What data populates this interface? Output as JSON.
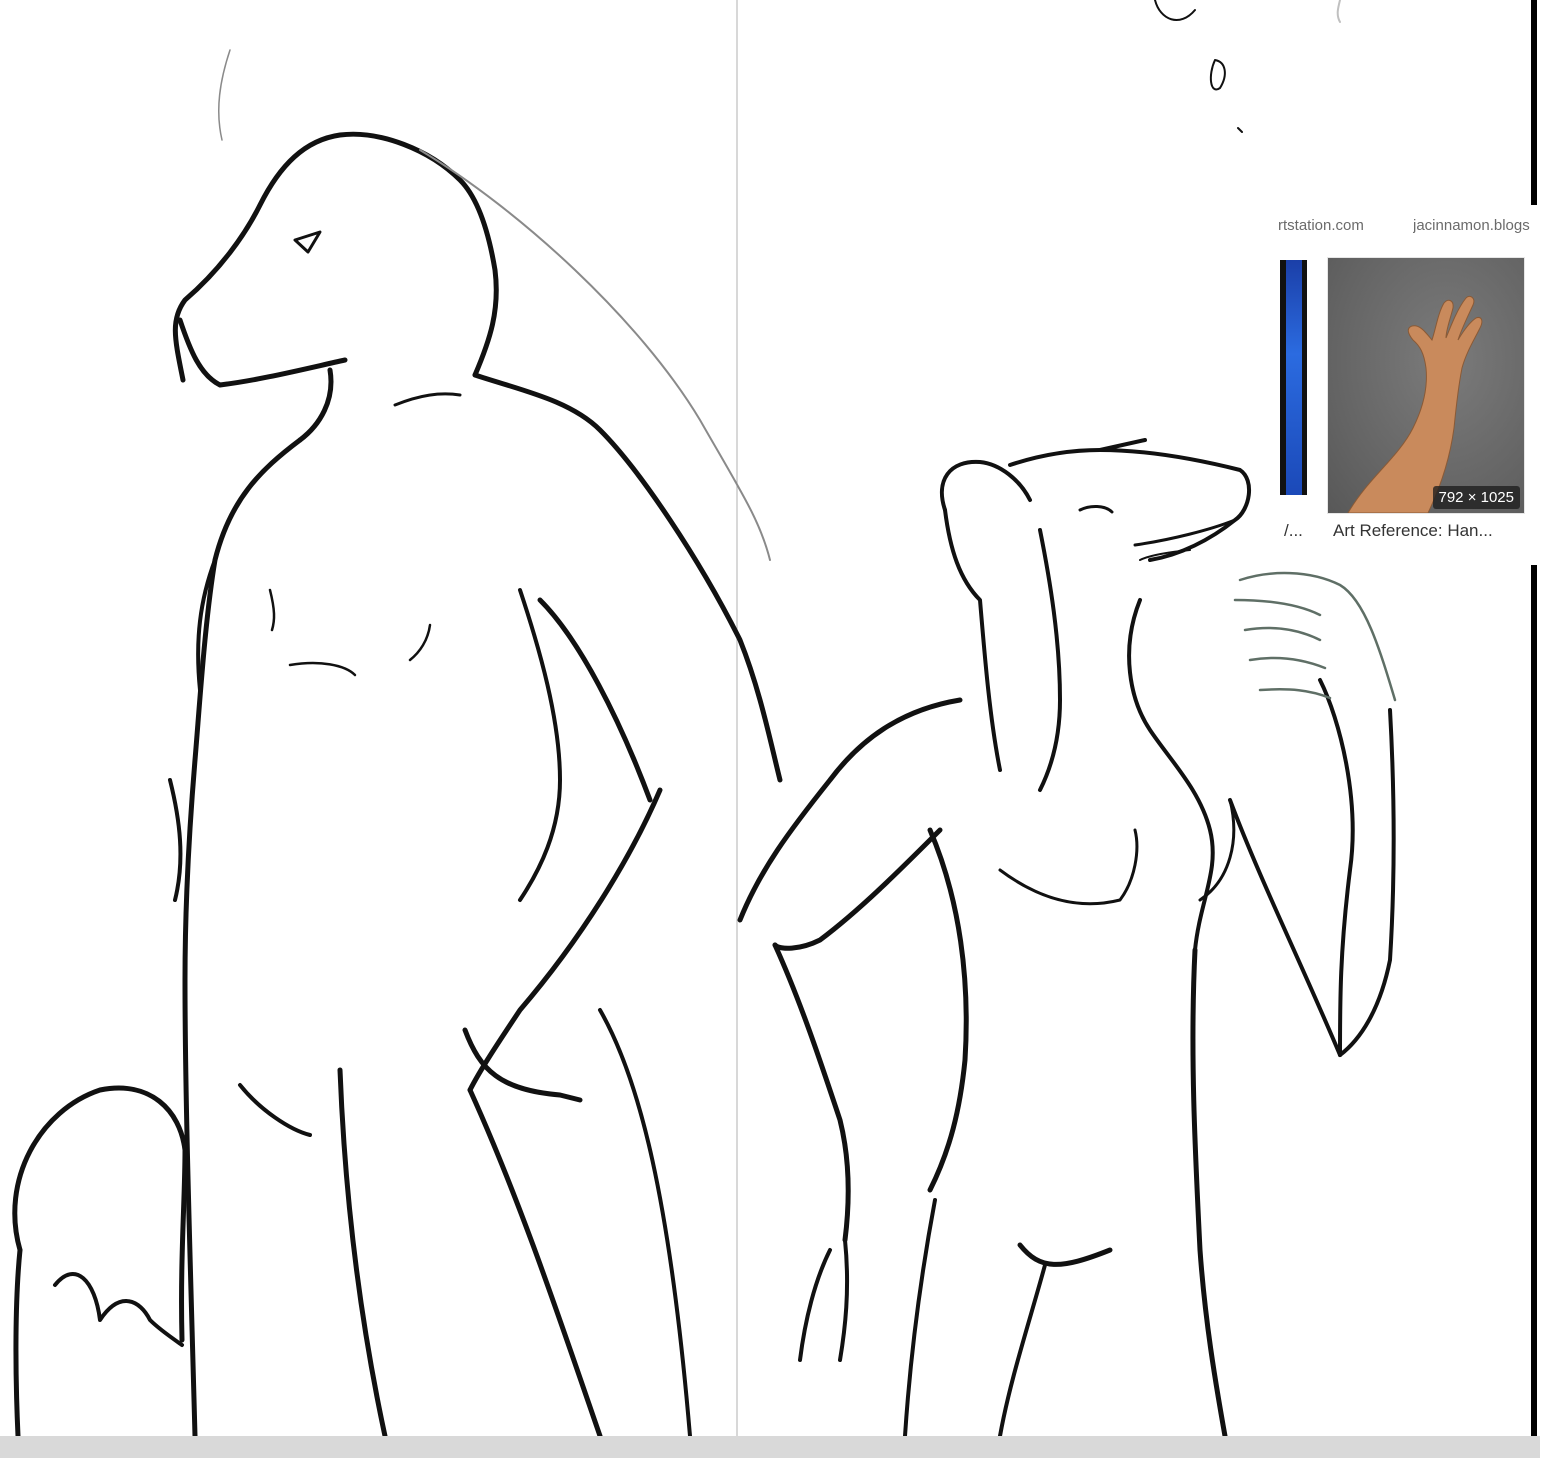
{
  "reference_panel": {
    "domain_left": "rtstation.com",
    "domain_right": "jacinnamon.blogs",
    "left_caption": "/...",
    "main_caption": "Art Reference: Han...",
    "main_dimensions": "792 × 1025"
  },
  "colors": {
    "line": "#111111",
    "sketch_light": "#8a8a8a",
    "ref_bg": "#636363",
    "skin": "#c98a5c",
    "bottom_bar": "#d9d9d9"
  },
  "icons": {
    "drawing": "sketch-lineart"
  }
}
